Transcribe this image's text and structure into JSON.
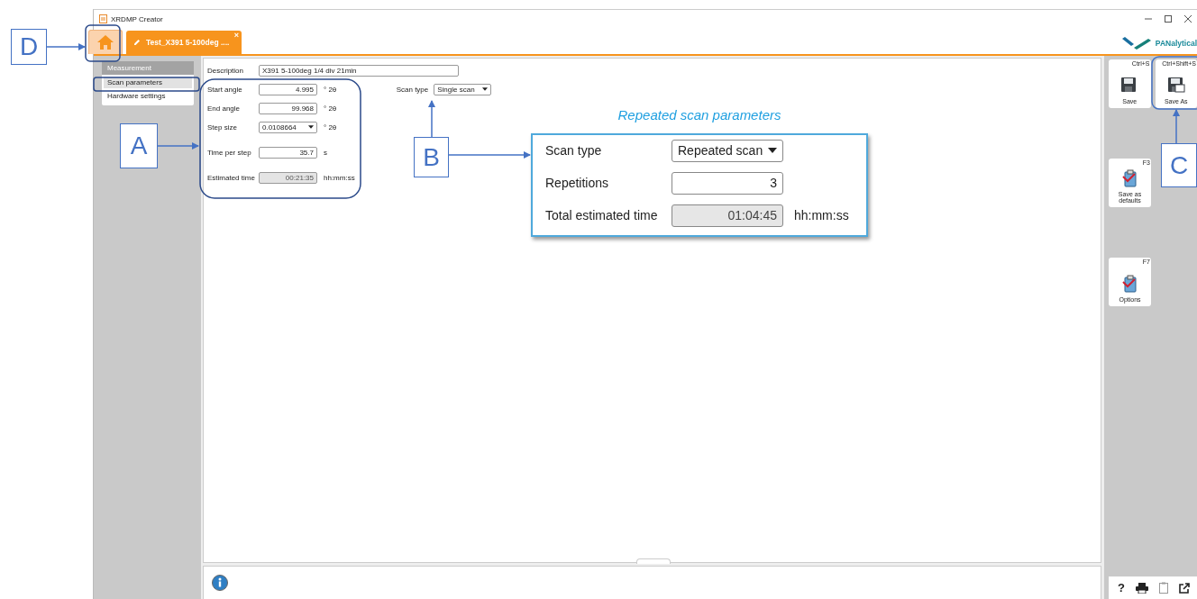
{
  "window": {
    "title": "XRDMP Creator"
  },
  "tabs": [
    {
      "kind": "home",
      "selected": false
    },
    {
      "kind": "document",
      "label": "Test_X391 5-100deg ....",
      "close": "×",
      "selected": true
    }
  ],
  "logo": {
    "text": "PANalytical"
  },
  "sidebar": {
    "header": "Measurement",
    "items": [
      {
        "label": "Scan parameters",
        "selected": true
      },
      {
        "label": "Hardware settings",
        "selected": false
      }
    ]
  },
  "form": {
    "description": {
      "label": "Description",
      "value": "X391 5-100deg 1/4 div 21min"
    },
    "rows": [
      {
        "label": "Start angle",
        "kind": "input",
        "value": "4.995",
        "unit": "° 2θ"
      },
      {
        "label": "End angle",
        "kind": "input",
        "value": "99.968",
        "unit": "° 2θ"
      },
      {
        "label": "Step size",
        "kind": "dropdown",
        "value": "0.0108664",
        "unit": "° 2θ"
      },
      {
        "label": "Time per step",
        "kind": "input",
        "value": "35.7",
        "unit": "s"
      },
      {
        "label": "Estimated time",
        "kind": "readonly",
        "value": "00:21:35",
        "unit": "hh:mm:ss"
      }
    ],
    "scan_type": {
      "label": "Scan type",
      "value": "Single scan"
    }
  },
  "toolbar": [
    {
      "label": "Save",
      "shortcut": "Ctrl+S",
      "kind": "save"
    },
    {
      "label": "Save As",
      "shortcut": "Ctrl+Shift+S",
      "kind": "save_as"
    },
    {
      "label": "Save as defaults",
      "shortcut": "F3",
      "kind": "clipboard"
    },
    {
      "label": "Options",
      "shortcut": "F7",
      "kind": "clipboard"
    }
  ],
  "bottom_tools": {
    "help": "?"
  },
  "annotations": {
    "callouts": [
      {
        "letter": "D"
      },
      {
        "letter": "A"
      },
      {
        "letter": "B"
      },
      {
        "letter": "C"
      }
    ],
    "inset": {
      "title": "Repeated scan parameters",
      "rows": [
        {
          "label": "Scan type",
          "kind": "dropdown",
          "value": "Repeated scan"
        },
        {
          "label": "Repetitions",
          "kind": "input",
          "value": "3"
        },
        {
          "label": "Total estimated time",
          "kind": "readonly",
          "value": "01:04:45",
          "unit": "hh:mm:ss"
        }
      ]
    }
  }
}
